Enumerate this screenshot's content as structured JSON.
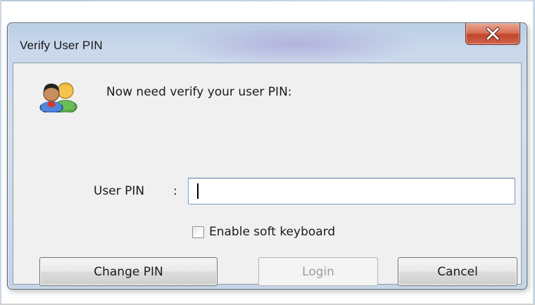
{
  "dialog": {
    "title": "Verify User PIN",
    "close_label": "X",
    "prompt": "Now need verify your user PIN:",
    "icon": "users-icon"
  },
  "form": {
    "pin_label": "User PIN",
    "pin_colon": ":",
    "pin_value": "",
    "soft_keyboard_label": "Enable soft keyboard",
    "soft_keyboard_checked": false
  },
  "buttons": {
    "change_pin": "Change PIN",
    "login": "Login",
    "login_enabled": false,
    "cancel": "Cancel"
  },
  "colors": {
    "close_button": "#c2452c",
    "client_bg": "#f0f0f0",
    "disabled_text": "#9c9c9c"
  }
}
